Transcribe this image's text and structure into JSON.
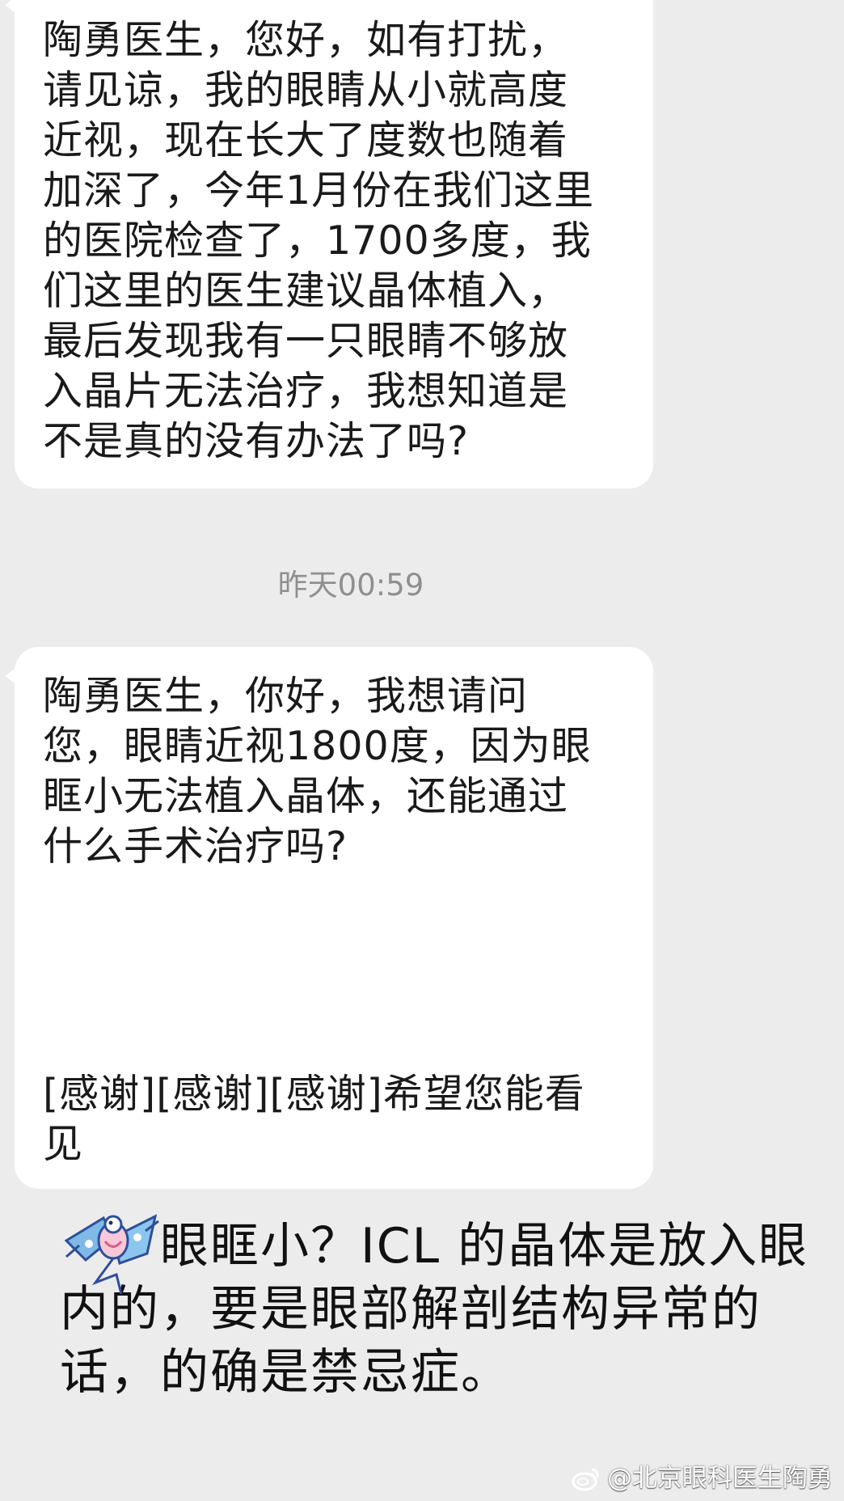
{
  "messages": [
    {
      "lines": [
        "陶勇医生，您好，如有打扰，",
        "请见谅，我的眼睛从小就高度",
        "近视，现在长大了度数也随着",
        "加深了，今年1月份在我们这里",
        "的医院检查了，1700多度，我",
        "们这里的医生建议晶体植入，",
        "最后发现我有一只眼睛不够放",
        "入晶片无法治疗，我想知道是",
        "不是真的没有办法了吗?"
      ]
    },
    {
      "timestamp": "昨天00:59",
      "lines": [
        "陶勇医生，你好，我想请问",
        "您，眼睛近视1800度，因为眼",
        "眶小无法植入晶体，还能通过",
        "什么手术治疗吗?"
      ],
      "tail_lines": [
        "[感谢][感谢][感谢]希望您能看",
        "见"
      ]
    }
  ],
  "reply": {
    "text": "眼眶小？ICL 的晶体是放入眼内的，要是眼部解剖结构异常的话，的确是禁忌症。",
    "icon": "kite-icon"
  },
  "watermark": {
    "text": "@北京眼科医生陶勇",
    "icon": "weibo-icon"
  },
  "colors": {
    "background": "#ececec",
    "bubble": "#ffffff",
    "timestamp": "#8f8f8f"
  }
}
